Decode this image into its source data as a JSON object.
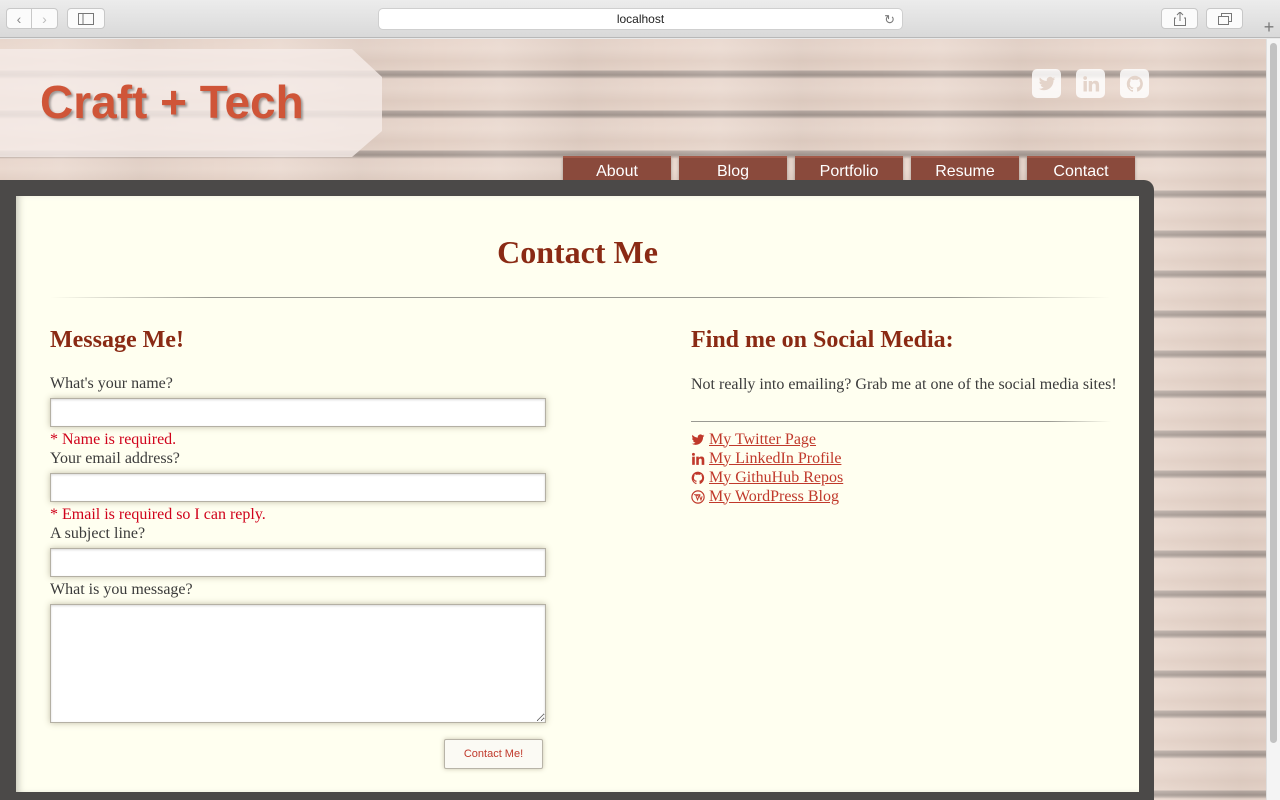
{
  "browser": {
    "url": "localhost"
  },
  "site": {
    "logo": "Craft + Tech",
    "social_icons": [
      "twitter-icon",
      "linkedin-icon",
      "github-icon"
    ],
    "nav": [
      "About",
      "Blog",
      "Portfolio",
      "Resume",
      "Contact"
    ]
  },
  "page": {
    "title": "Contact Me"
  },
  "form": {
    "heading": "Message Me!",
    "name_label": "What's your name?",
    "name_value": "",
    "name_error": "* Name is required.",
    "email_label": "Your email address?",
    "email_value": "",
    "email_error": "* Email is required so I can reply.",
    "subject_label": "A subject line?",
    "subject_value": "",
    "message_label": "What is you message?",
    "message_value": "",
    "submit_label": "Contact Me!"
  },
  "social": {
    "heading": "Find me on Social Media:",
    "intro": "Not really into emailing? Grab me at one of the social media sites!",
    "links": [
      {
        "icon": "twitter-icon",
        "label": " My Twitter Page"
      },
      {
        "icon": "linkedin-icon",
        "label": " My LinkedIn Profile"
      },
      {
        "icon": "github-icon",
        "label": " My GithuHub Repos"
      },
      {
        "icon": "wordpress-icon",
        "label": " My WordPress Blog"
      }
    ]
  },
  "colors": {
    "accent": "#8a2a14",
    "link": "#c0392b",
    "error": "#d0021b",
    "nav_tab": "#8a4a3c",
    "panel": "#fffff0"
  }
}
